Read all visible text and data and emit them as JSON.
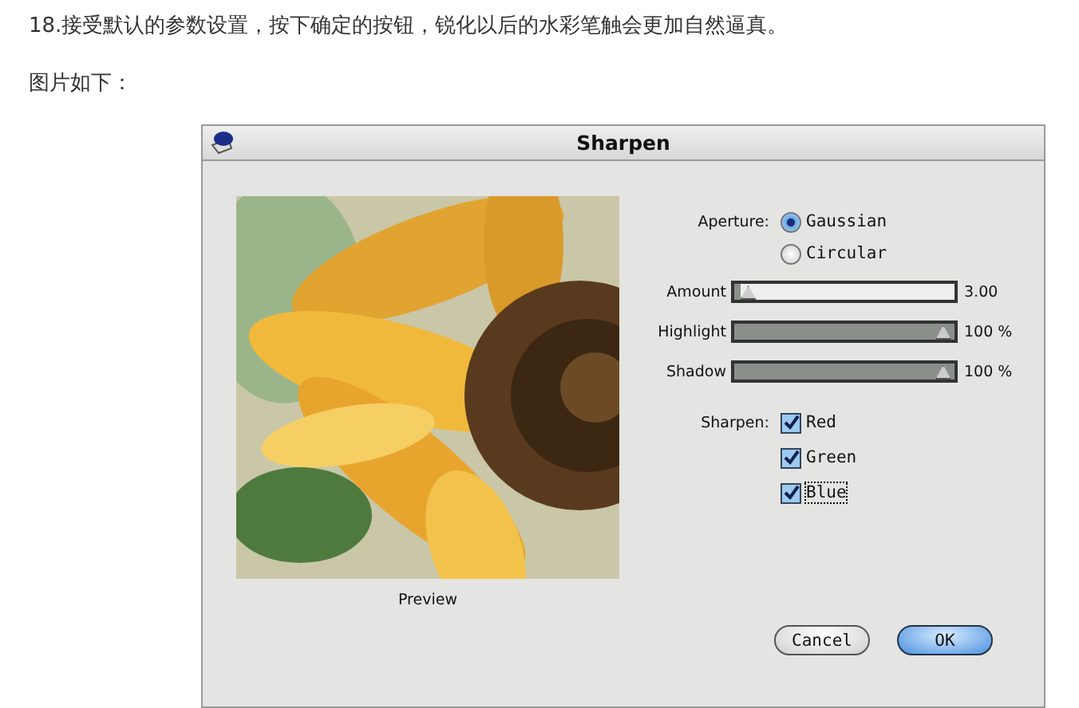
{
  "article": {
    "paragraphs": [
      "18.接受默认的参数设置，按下确定的按钮，锐化以后的水彩笔触会更加自然逼真。",
      "图片如下："
    ]
  },
  "dialog": {
    "title": "Sharpen",
    "preview": {
      "kind": "picture",
      "label": "Preview"
    },
    "aperture": {
      "label": "Aperture:",
      "options": [
        {
          "label": "Gaussian",
          "selected": true
        },
        {
          "label": "Circular",
          "selected": false
        }
      ]
    },
    "sliders": [
      {
        "label": "Amount",
        "level": 0.03,
        "reading": "3.00"
      },
      {
        "label": "Highlight",
        "level": 1,
        "reading": "100 %"
      },
      {
        "label": "Shadow",
        "level": 1,
        "reading": "100 %"
      }
    ],
    "sharpen": {
      "label": "Sharpen:",
      "channels": [
        {
          "label": "Red",
          "checked": true,
          "focused": false
        },
        {
          "label": "Green",
          "checked": true,
          "focused": false
        },
        {
          "label": "Blue",
          "checked": true,
          "focused": true
        }
      ]
    },
    "buttons": [
      {
        "label": "Cancel",
        "default": false
      },
      {
        "label": "OK",
        "default": true
      }
    ]
  }
}
